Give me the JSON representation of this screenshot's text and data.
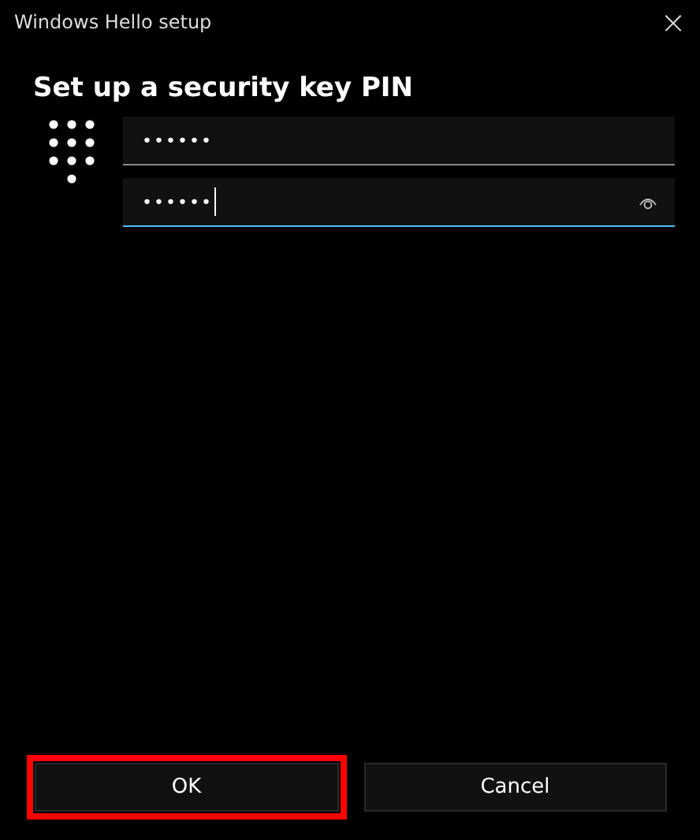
{
  "window": {
    "title": "Windows Hello setup",
    "close": "×"
  },
  "heading": "Set up a security key PIN",
  "fields": [
    {
      "value": "••••••",
      "focused": false,
      "reveal": false
    },
    {
      "value": "••••••",
      "focused": true,
      "reveal": true
    }
  ],
  "buttons": [
    {
      "label": "OK",
      "highlighted": true
    },
    {
      "label": "Cancel",
      "highlighted": false
    }
  ]
}
